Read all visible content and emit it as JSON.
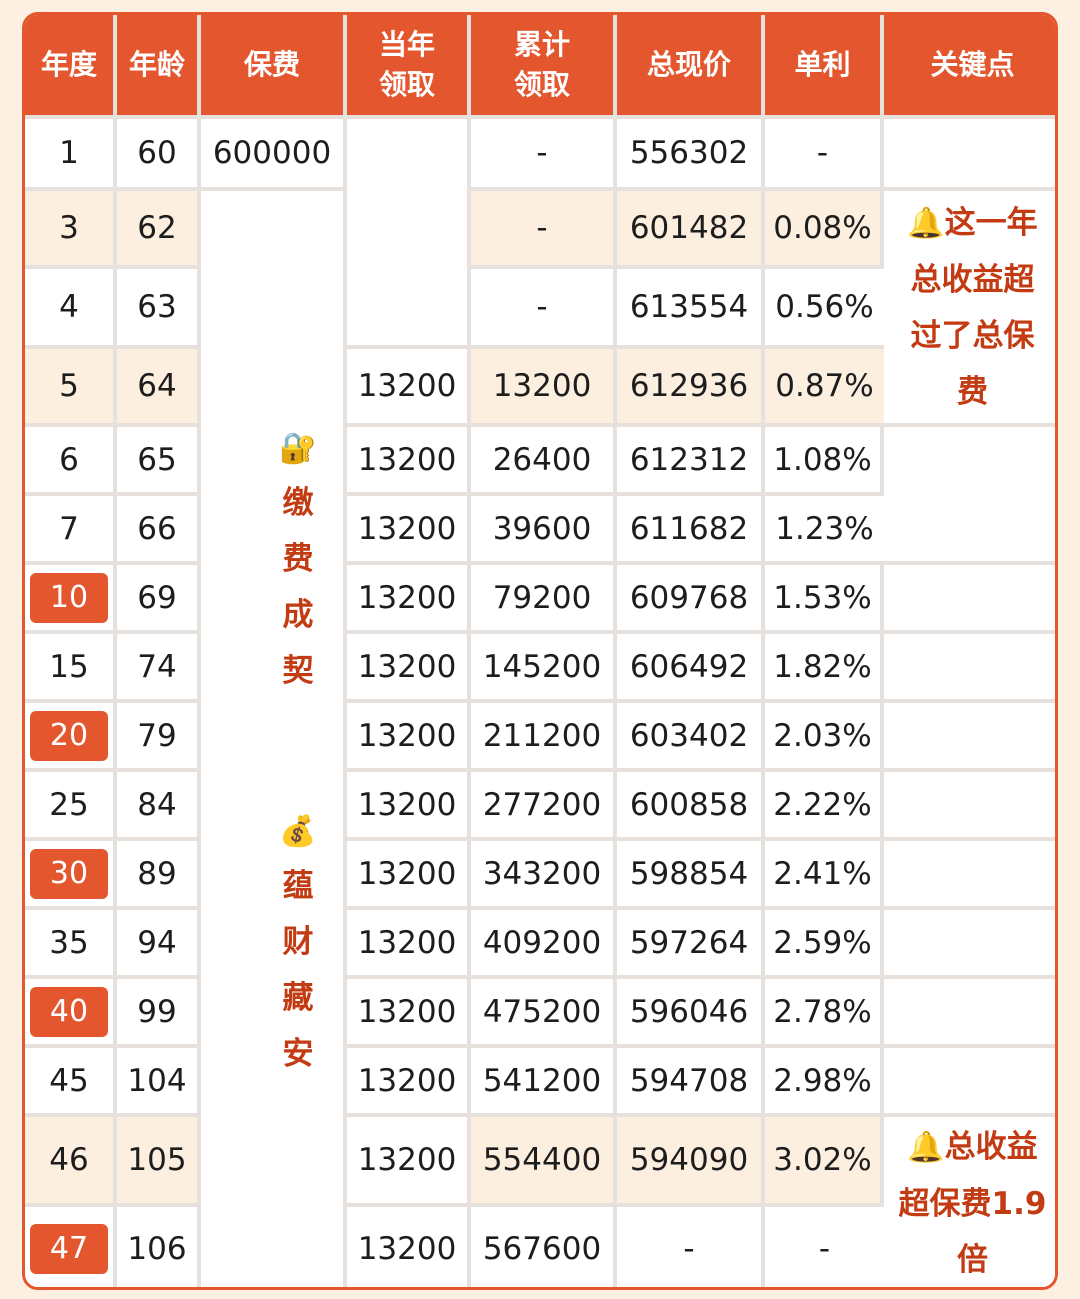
{
  "colors": {
    "accent": "#e4572e",
    "highlight": "#fcefdf",
    "note_text": "#c23b12"
  },
  "headers": {
    "year": "年度",
    "age": "年龄",
    "premium": "保费",
    "annual_line1": "当年",
    "annual_line2": "领取",
    "cumulative_line1": "累计",
    "cumulative_line2": "领取",
    "cash_value": "总现价",
    "simple_rate": "单利",
    "key_point": "关键点"
  },
  "rows": [
    {
      "year": "1",
      "age": "60",
      "premium": "600000",
      "annual": "",
      "cumulative": "-",
      "cash": "556302",
      "rate": "-"
    },
    {
      "year": "3",
      "age": "62",
      "annual": "",
      "cumulative": "-",
      "cash": "601482",
      "rate": "0.08%"
    },
    {
      "year": "4",
      "age": "63",
      "annual": "",
      "cumulative": "-",
      "cash": "613554",
      "rate": "0.56%"
    },
    {
      "year": "5",
      "age": "64",
      "annual": "13200",
      "cumulative": "13200",
      "cash": "612936",
      "rate": "0.87%"
    },
    {
      "year": "6",
      "age": "65",
      "annual": "13200",
      "cumulative": "26400",
      "cash": "612312",
      "rate": "1.08%"
    },
    {
      "year": "7",
      "age": "66",
      "annual": "13200",
      "cumulative": "39600",
      "cash": "611682",
      "rate": "1.23%"
    },
    {
      "year": "10",
      "age": "69",
      "annual": "13200",
      "cumulative": "79200",
      "cash": "609768",
      "rate": "1.53%"
    },
    {
      "year": "15",
      "age": "74",
      "annual": "13200",
      "cumulative": "145200",
      "cash": "606492",
      "rate": "1.82%"
    },
    {
      "year": "20",
      "age": "79",
      "annual": "13200",
      "cumulative": "211200",
      "cash": "603402",
      "rate": "2.03%"
    },
    {
      "year": "25",
      "age": "84",
      "annual": "13200",
      "cumulative": "277200",
      "cash": "600858",
      "rate": "2.22%"
    },
    {
      "year": "30",
      "age": "89",
      "annual": "13200",
      "cumulative": "343200",
      "cash": "598854",
      "rate": "2.41%"
    },
    {
      "year": "35",
      "age": "94",
      "annual": "13200",
      "cumulative": "409200",
      "cash": "597264",
      "rate": "2.59%"
    },
    {
      "year": "40",
      "age": "99",
      "annual": "13200",
      "cumulative": "475200",
      "cash": "596046",
      "rate": "2.78%"
    },
    {
      "year": "45",
      "age": "104",
      "annual": "13200",
      "cumulative": "541200",
      "cash": "594708",
      "rate": "2.98%"
    },
    {
      "year": "46",
      "age": "105",
      "annual": "13200",
      "cumulative": "554400",
      "cash": "594090",
      "rate": "3.02%"
    },
    {
      "year": "47",
      "age": "106",
      "annual": "13200",
      "cumulative": "567600",
      "cash": "-",
      "rate": "-"
    }
  ],
  "premium_note": {
    "icon": "lock-key-icon",
    "icon_glyph": "🔐",
    "chars": [
      "缴",
      "费",
      "成",
      "契"
    ]
  },
  "wealth_note": {
    "icon": "money-bag-icon",
    "icon_glyph": "💰",
    "chars": [
      "蕴",
      "财",
      "藏",
      "安"
    ]
  },
  "key_notes": {
    "note1": {
      "icon": "bell-icon",
      "icon_glyph": "🔔",
      "lines": [
        "这一年",
        "总收益超",
        "过了总保",
        "费"
      ]
    },
    "note2": {
      "icon": "bell-icon",
      "icon_glyph": "🔔",
      "lines": [
        "总收益",
        "超保费1.9",
        "倍"
      ]
    }
  }
}
